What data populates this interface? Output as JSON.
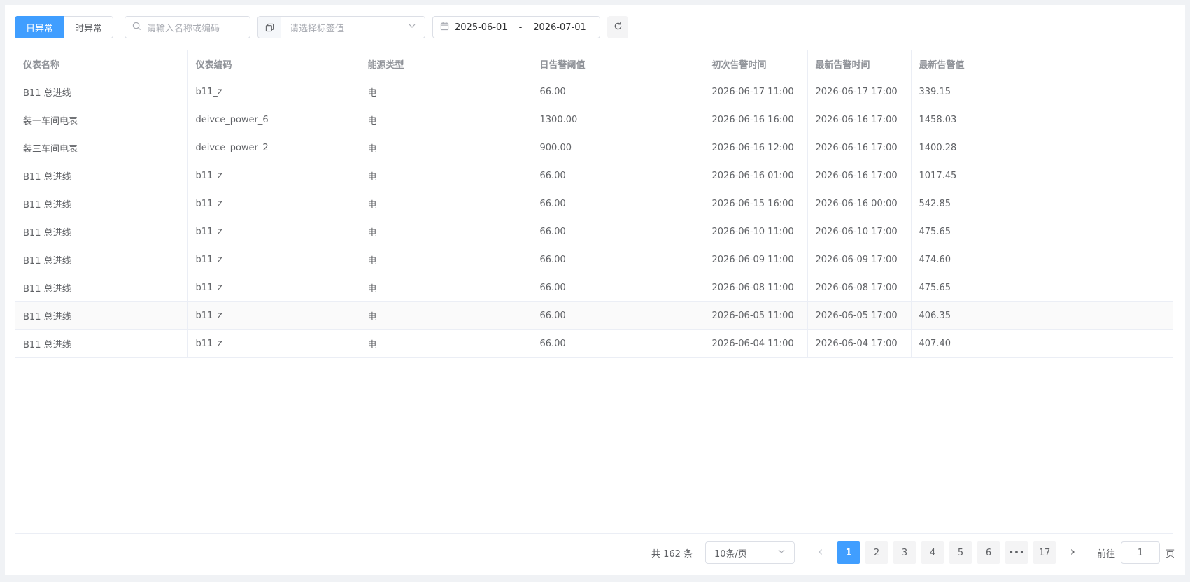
{
  "toolbar": {
    "tabs": [
      {
        "label": "日异常",
        "active": true
      },
      {
        "label": "时异常",
        "active": false
      }
    ],
    "search_placeholder": "请输入名称或编码",
    "tag_placeholder": "请选择标签值",
    "date_start": "2025-06-01",
    "date_sep": "-",
    "date_end": "2026-07-01"
  },
  "table": {
    "columns": [
      "仪表名称",
      "仪表编码",
      "能源类型",
      "日告警阈值",
      "初次告警时间",
      "最新告警时间",
      "最新告警值"
    ],
    "rows": [
      [
        "B11 总进线",
        "b11_z",
        "电",
        "66.00",
        "2026-06-17 11:00",
        "2026-06-17 17:00",
        "339.15"
      ],
      [
        "装一车间电表",
        "deivce_power_6",
        "电",
        "1300.00",
        "2026-06-16 16:00",
        "2026-06-16 17:00",
        "1458.03"
      ],
      [
        "装三车间电表",
        "deivce_power_2",
        "电",
        "900.00",
        "2026-06-16 12:00",
        "2026-06-16 17:00",
        "1400.28"
      ],
      [
        "B11 总进线",
        "b11_z",
        "电",
        "66.00",
        "2026-06-16 01:00",
        "2026-06-16 17:00",
        "1017.45"
      ],
      [
        "B11 总进线",
        "b11_z",
        "电",
        "66.00",
        "2026-06-15 16:00",
        "2026-06-16 00:00",
        "542.85"
      ],
      [
        "B11 总进线",
        "b11_z",
        "电",
        "66.00",
        "2026-06-10 11:00",
        "2026-06-10 17:00",
        "475.65"
      ],
      [
        "B11 总进线",
        "b11_z",
        "电",
        "66.00",
        "2026-06-09 11:00",
        "2026-06-09 17:00",
        "474.60"
      ],
      [
        "B11 总进线",
        "b11_z",
        "电",
        "66.00",
        "2026-06-08 11:00",
        "2026-06-08 17:00",
        "475.65"
      ],
      [
        "B11 总进线",
        "b11_z",
        "电",
        "66.00",
        "2026-06-05 11:00",
        "2026-06-05 17:00",
        "406.35"
      ],
      [
        "B11 总进线",
        "b11_z",
        "电",
        "66.00",
        "2026-06-04 11:00",
        "2026-06-04 17:00",
        "407.40"
      ]
    ]
  },
  "pagination": {
    "total": "共 162 条",
    "page_size": "10条/页",
    "pages": [
      "1",
      "2",
      "3",
      "4",
      "5",
      "6",
      "•••",
      "17"
    ],
    "current": "1",
    "goto_prefix": "前往",
    "goto_value": "1",
    "goto_suffix": "页"
  },
  "icons": {
    "search": "search-icon",
    "copy": "copy-icon",
    "chevron": "chevron-down-icon",
    "calendar": "calendar-icon",
    "refresh": "refresh-icon",
    "prev": "chevron-left-icon",
    "next": "chevron-right-icon"
  },
  "colors": {
    "accent": "#409eff",
    "background": "#f0f2f5"
  }
}
